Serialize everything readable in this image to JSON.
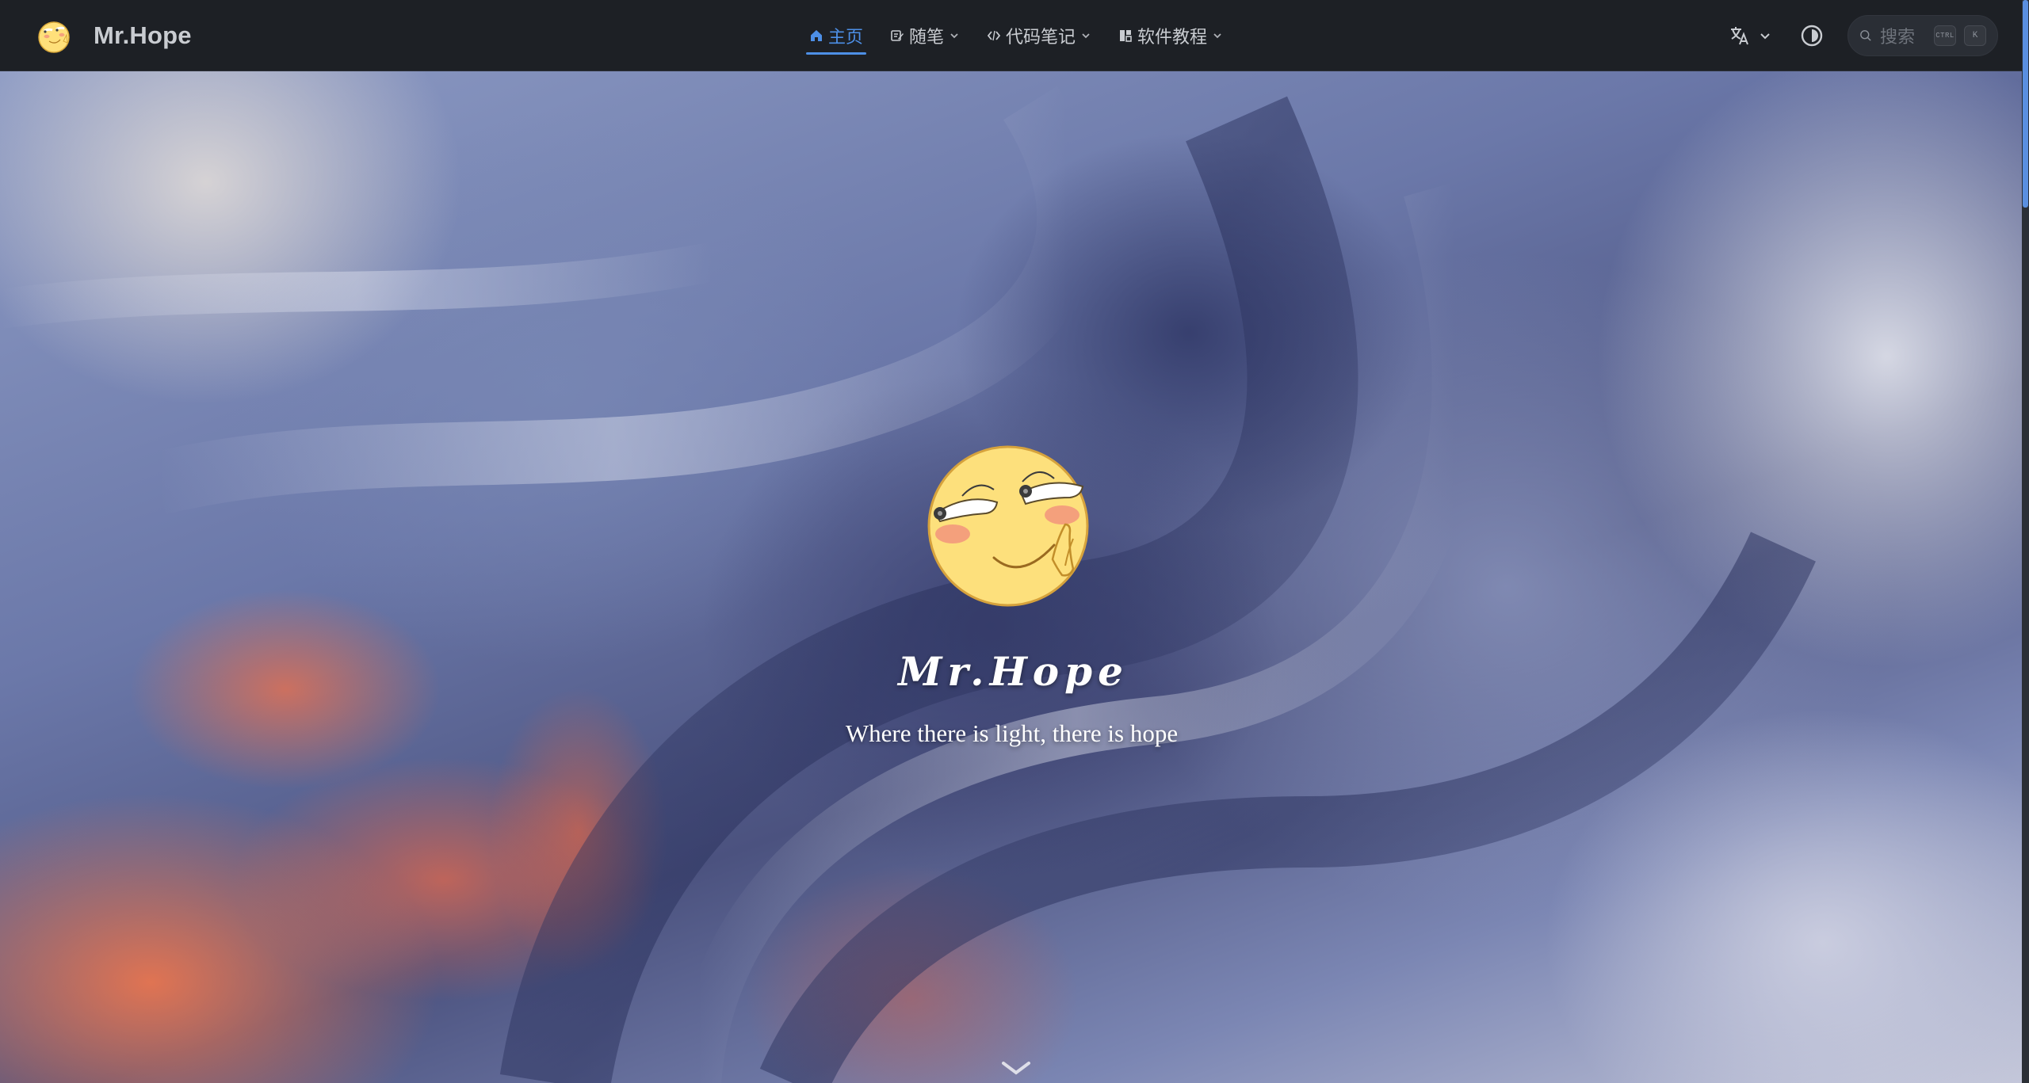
{
  "navbar": {
    "brand_name": "Mr.Hope",
    "links": [
      {
        "label": "主页",
        "icon": "home-icon",
        "active": true,
        "dropdown": false
      },
      {
        "label": "随笔",
        "icon": "pen-icon",
        "active": false,
        "dropdown": true
      },
      {
        "label": "代码笔记",
        "icon": "code-icon",
        "active": false,
        "dropdown": true
      },
      {
        "label": "软件教程",
        "icon": "software-icon",
        "active": false,
        "dropdown": true
      }
    ],
    "language_icon": "translate-icon",
    "theme_icon": "contrast-icon",
    "search": {
      "placeholder": "搜索",
      "shortcut_keys": [
        "CTRL",
        "K"
      ]
    },
    "active_color": "#4d8fe6"
  },
  "hero": {
    "title": "Mr.Hope",
    "description": "Where there is light, there is hope",
    "avatar_icon": "smirk-emoji-avatar",
    "scroll_icon": "chevron-down-icon"
  },
  "colors": {
    "navbar_bg": "#1d2025",
    "accent": "#4d8fe6",
    "text": "#c9ccd1"
  }
}
